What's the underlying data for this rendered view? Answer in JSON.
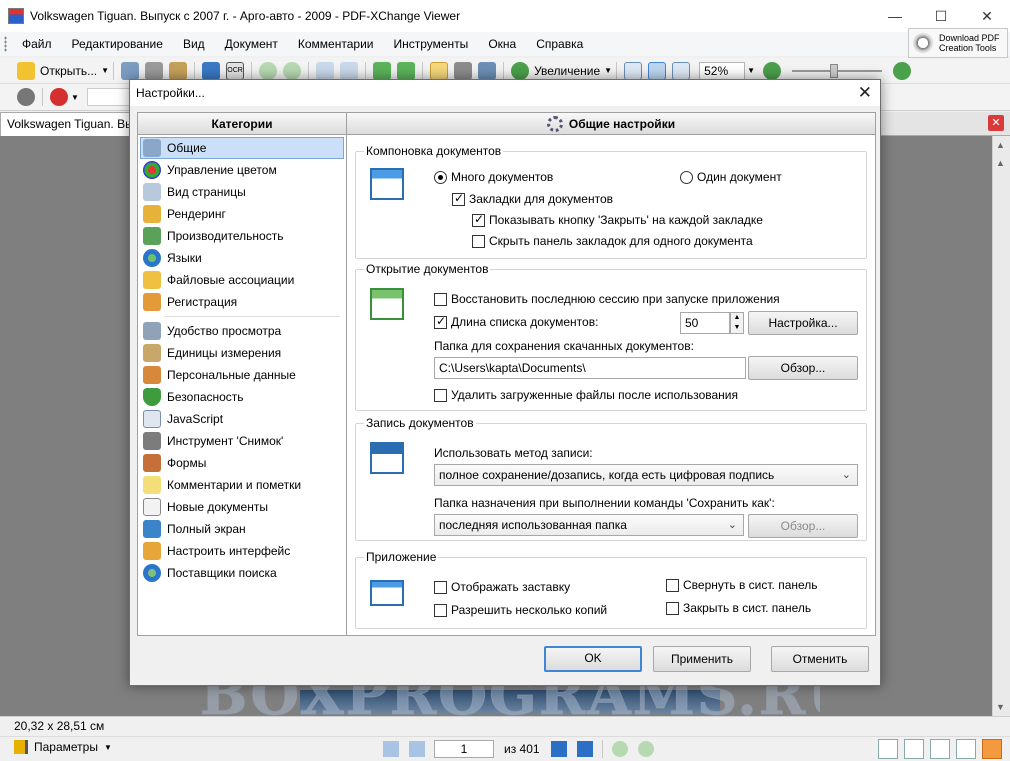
{
  "window": {
    "title": "Volkswagen Tiguan. Выпуск с 2007 г. - Арго-авто - 2009 - PDF-XChange Viewer",
    "minimize": "—",
    "maximize": "☐",
    "close": "✕"
  },
  "menu": [
    "Файл",
    "Редактирование",
    "Вид",
    "Документ",
    "Комментарии",
    "Инструменты",
    "Окна",
    "Справка"
  ],
  "download_button": {
    "line1": "Download PDF",
    "line2": "Creation Tools"
  },
  "toolbar": {
    "open_label": "Открыть...",
    "zoom_label": "Увеличение",
    "zoom_value": "52%"
  },
  "document_tab": {
    "label": "Volkswagen Tiguan. Вы",
    "close": "✕"
  },
  "statusbar": {
    "page_size": "20,32 x 28,51 см"
  },
  "navbar": {
    "params_label": "Параметры",
    "current_page": "1",
    "page_count": "из 401"
  },
  "watermark": "BOXPROGRAMS.RU",
  "dialog": {
    "title": "Настройки...",
    "close": "✕",
    "categories_header": "Категории",
    "categories_group1": [
      "Общие",
      "Управление цветом",
      "Вид страницы",
      "Рендеринг",
      "Производительность",
      "Языки",
      "Файловые ассоциации",
      "Регистрация"
    ],
    "categories_group2": [
      "Удобство просмотра",
      "Единицы измерения",
      "Персональные данные",
      "Безопасность",
      "JavaScript",
      "Инструмент 'Снимок'",
      "Формы",
      "Комментарии и пометки",
      "Новые документы",
      "Полный экран",
      "Настроить интерфейс",
      "Поставщики поиска"
    ],
    "settings_header": "Общие настройки",
    "layout_group": {
      "label": "Компоновка документов",
      "many_docs": "Много документов",
      "one_doc": "Один документ",
      "tabs": "Закладки для документов",
      "show_close": "Показывать кнопку 'Закрыть' на каждой закладке",
      "hide_tabbar": "Скрыть панель закладок для одного документа"
    },
    "open_group": {
      "label": "Открытие документов",
      "restore_session": "Восстановить последнюю сессию при запуске приложения",
      "list_length": "Длина списка документов:",
      "list_length_value": "50",
      "setup_button": "Настройка...",
      "download_folder_label": "Папка для сохранения скачанных документов:",
      "download_folder_value": "C:\\Users\\kapta\\Documents\\",
      "browse_button": "Обзор...",
      "delete_downloaded": "Удалить загруженные файлы после использования"
    },
    "save_group": {
      "label": "Запись документов",
      "method_label": "Использовать метод записи:",
      "method_value": "полное сохранение/дозапись, когда есть цифровая подпись",
      "dest_label": "Папка назначения при выполнении команды 'Сохранить как':",
      "dest_value": "последняя использованная папка",
      "browse_button": "Обзор..."
    },
    "app_group": {
      "label": "Приложение",
      "splash": "Отображать заставку",
      "multi_instance": "Разрешить несколько копий",
      "minimize_tray": "Свернуть в сист. панель",
      "close_tray": "Закрыть в сист. панель"
    },
    "buttons": {
      "ok": "OK",
      "apply": "Применить",
      "cancel": "Отменить"
    }
  },
  "colors": {
    "accent": "#3f86d6",
    "selection": "#cbe0f8",
    "workspace": "#7f7f7f"
  }
}
